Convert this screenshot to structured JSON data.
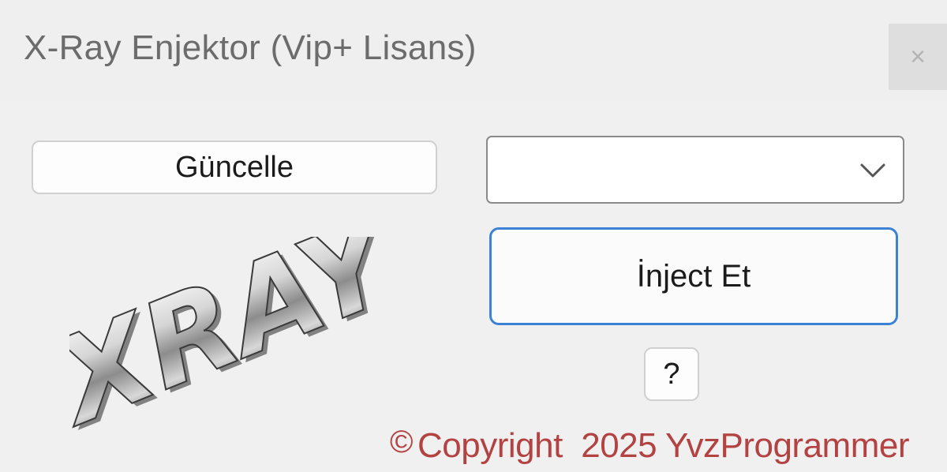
{
  "window": {
    "title": "X-Ray Enjektor (Vip+ Lisans)",
    "close_label": "×"
  },
  "controls": {
    "update_label": "Güncelle",
    "dropdown_value": "",
    "inject_label": "İnject Et",
    "help_label": "?"
  },
  "logo": {
    "text": "XRAY",
    "icon": "xray-logo"
  },
  "footer": {
    "copyright_symbol": "©",
    "copyright_text": "Copyright  2025 YvzProgrammer"
  },
  "colors": {
    "background": "#f0f0f0",
    "accent": "#3c82d4",
    "copyright": "#b34242",
    "title": "#6c6c6c"
  }
}
